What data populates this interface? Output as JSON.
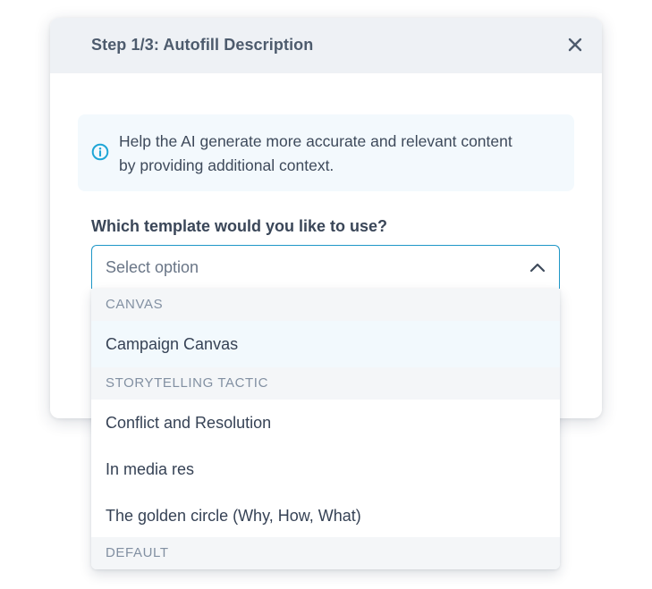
{
  "modal": {
    "title": "Step 1/3: Autofill Description",
    "close_icon": "close-icon",
    "info": {
      "icon": "info-icon",
      "text_line1": "Help the AI generate more accurate and relevant content",
      "text_line2": "by providing additional context."
    },
    "question": "Which template would you like to use?",
    "select": {
      "placeholder": "Select option",
      "icon": "chevron-up-icon",
      "border_color": "#1f97c7"
    }
  },
  "dropdown": {
    "groups": [
      {
        "header": "CANVAS",
        "options": [
          "Campaign Canvas"
        ]
      },
      {
        "header": "STORYTELLING TACTIC",
        "options": [
          "Conflict and Resolution",
          "In media res",
          "The golden circle (Why, How, What)"
        ]
      },
      {
        "header": "DEFAULT",
        "options": []
      }
    ],
    "highlighted_option": "Campaign Canvas"
  },
  "colors": {
    "accent": "#1fa6d6",
    "header_bg": "#eef1f5",
    "info_bg": "#f3f9fd"
  }
}
